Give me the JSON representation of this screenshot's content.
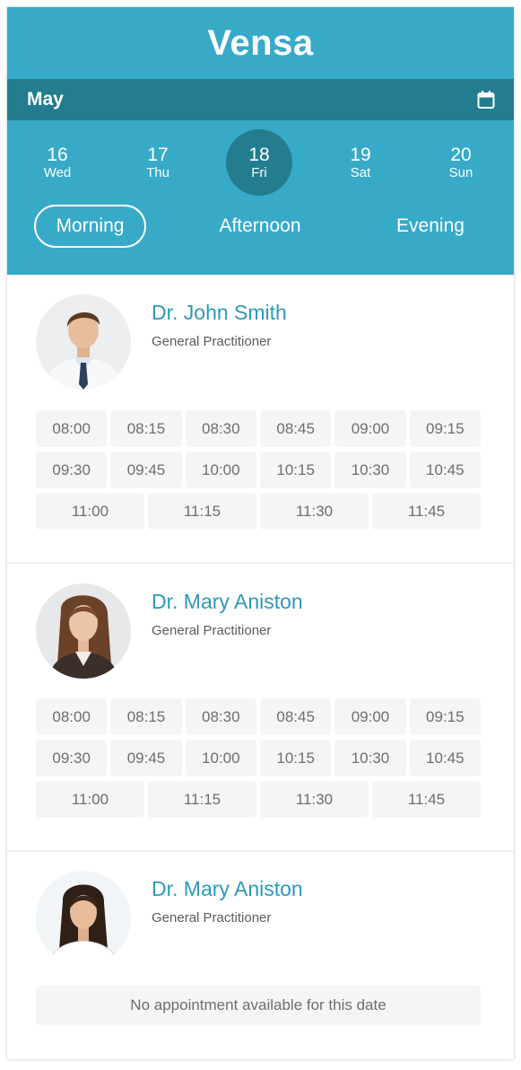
{
  "app": {
    "title": "Vensa"
  },
  "month": {
    "label": "May",
    "icon": "calendar-icon"
  },
  "days": [
    {
      "num": "16",
      "dow": "Wed",
      "selected": false
    },
    {
      "num": "17",
      "dow": "Thu",
      "selected": false
    },
    {
      "num": "18",
      "dow": "Fri",
      "selected": true
    },
    {
      "num": "19",
      "dow": "Sat",
      "selected": false
    },
    {
      "num": "20",
      "dow": "Sun",
      "selected": false
    }
  ],
  "periods": {
    "morning": "Morning",
    "afternoon": "Afternoon",
    "evening": "Evening",
    "active": "Morning"
  },
  "doctors": [
    {
      "name": "Dr. John Smith",
      "role": "General Practitioner",
      "slots": [
        [
          "08:00",
          "08:15",
          "08:30",
          "08:45",
          "09:00",
          "09:15"
        ],
        [
          "09:30",
          "09:45",
          "10:00",
          "10:15",
          "10:30",
          "10:45"
        ],
        [
          "11:00",
          "11:15",
          "11:30",
          "11:45"
        ]
      ]
    },
    {
      "name": "Dr. Mary Aniston",
      "role": "General Practitioner",
      "slots": [
        [
          "08:00",
          "08:15",
          "08:30",
          "08:45",
          "09:00",
          "09:15"
        ],
        [
          "09:30",
          "09:45",
          "10:00",
          "10:15",
          "10:30",
          "10:45"
        ],
        [
          "11:00",
          "11:15",
          "11:30",
          "11:45"
        ]
      ]
    },
    {
      "name": "Dr. Mary Aniston",
      "role": "General Practitioner",
      "no_appointment": "No appointment available for this date"
    }
  ],
  "colors": {
    "header": "#37aac8",
    "month_bar": "#237d8f",
    "selected_day": "#237d8f",
    "doctor_name": "#2c9ab8"
  }
}
